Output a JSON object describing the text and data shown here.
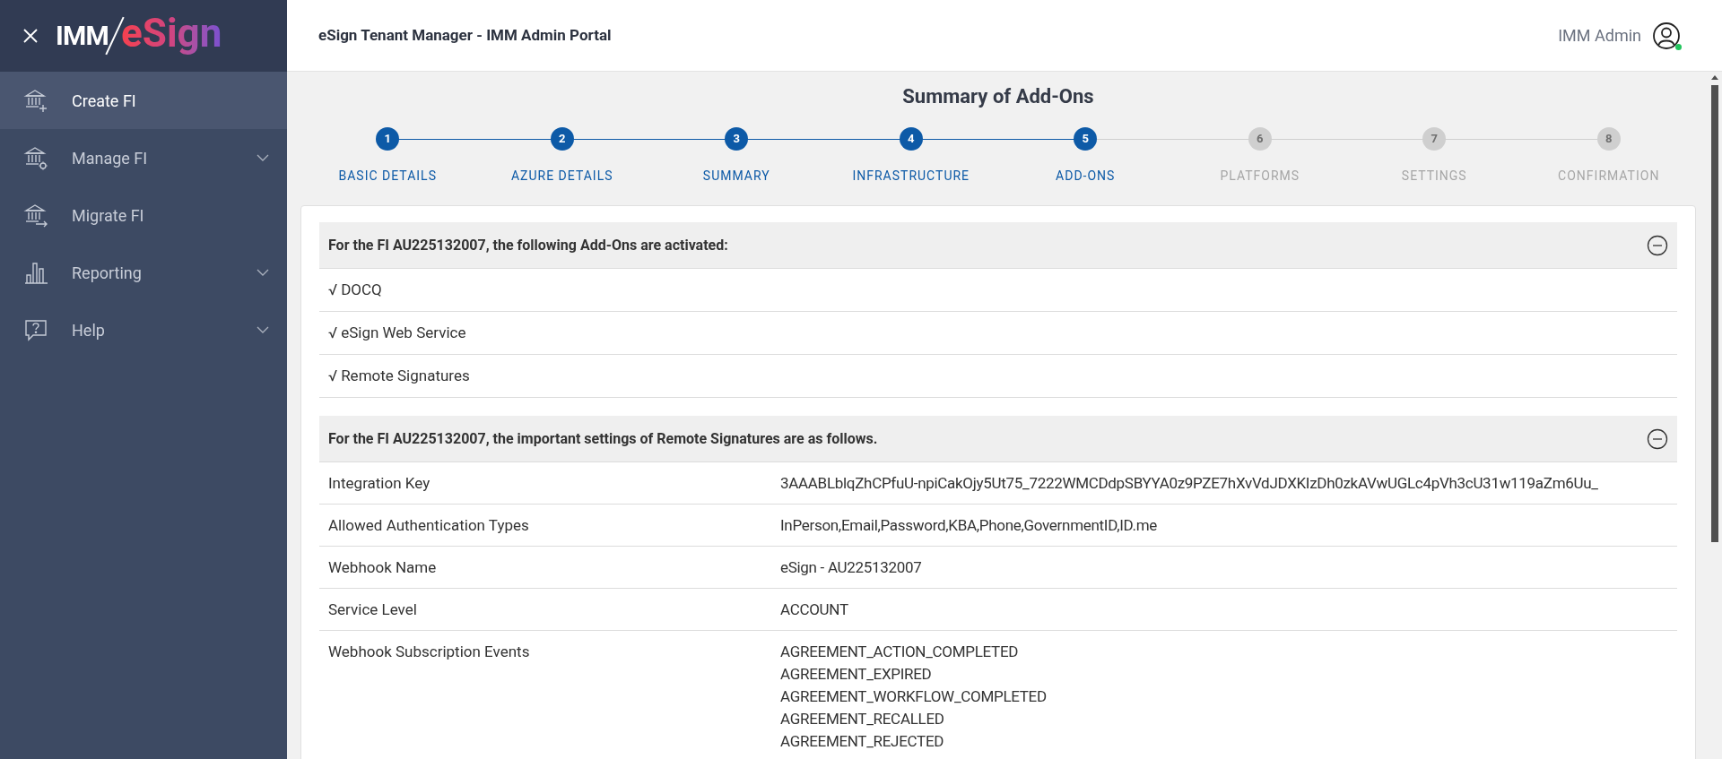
{
  "logo": {
    "left": "IMM",
    "right": "eSign"
  },
  "sidebar": {
    "items": [
      {
        "label": "Create FI",
        "selected": true,
        "expandable": false
      },
      {
        "label": "Manage FI",
        "selected": false,
        "expandable": true
      },
      {
        "label": "Migrate FI",
        "selected": false,
        "expandable": false
      },
      {
        "label": "Reporting",
        "selected": false,
        "expandable": true
      },
      {
        "label": "Help",
        "selected": false,
        "expandable": true
      }
    ]
  },
  "header": {
    "title": "eSign Tenant Manager - IMM Admin Portal",
    "user": "IMM Admin",
    "online": true
  },
  "page_title": "Summary of Add-Ons",
  "steps": [
    {
      "number": "1",
      "label": "BASIC DETAILS",
      "completed": true
    },
    {
      "number": "2",
      "label": "AZURE DETAILS",
      "completed": true
    },
    {
      "number": "3",
      "label": "SUMMARY",
      "completed": true
    },
    {
      "number": "4",
      "label": "INFRASTRUCTURE",
      "completed": true
    },
    {
      "number": "5",
      "label": "ADD-ONS",
      "completed": true
    },
    {
      "number": "6",
      "label": "PLATFORMS",
      "completed": false
    },
    {
      "number": "7",
      "label": "SETTINGS",
      "completed": false
    },
    {
      "number": "8",
      "label": "CONFIRMATION",
      "completed": false
    }
  ],
  "sections": [
    {
      "kind": "list",
      "title": "For the FI AU225132007, the following Add-Ons are activated:",
      "expanded": true,
      "items": [
        {
          "mark": "√",
          "label": "DOCQ"
        },
        {
          "mark": "√",
          "label": "eSign Web Service"
        },
        {
          "mark": "√",
          "label": "Remote Signatures"
        }
      ]
    },
    {
      "kind": "table",
      "title": "For the FI AU225132007, the important settings of Remote Signatures are as follows.",
      "expanded": true,
      "rows": [
        {
          "label": "Integration Key",
          "values": [
            "3AAABLblqZhCPfuU-npiCakOjy5Ut75_7222WMCDdpSBYYA0z9PZE7hXvVdJDXKIzDh0zkAVwUGLc4pVh3cU31w119aZm6Uu_"
          ]
        },
        {
          "label": "Allowed Authentication Types",
          "values": [
            "InPerson,Email,Password,KBA,Phone,GovernmentID,ID.me"
          ]
        },
        {
          "label": "Webhook Name",
          "values": [
            "eSign - AU225132007"
          ]
        },
        {
          "label": "Service Level",
          "values": [
            "ACCOUNT"
          ]
        },
        {
          "label": "Webhook Subscription Events",
          "values": [
            "AGREEMENT_ACTION_COMPLETED",
            "AGREEMENT_EXPIRED",
            "AGREEMENT_WORKFLOW_COMPLETED",
            "AGREEMENT_RECALLED",
            "AGREEMENT_REJECTED"
          ]
        }
      ]
    }
  ]
}
